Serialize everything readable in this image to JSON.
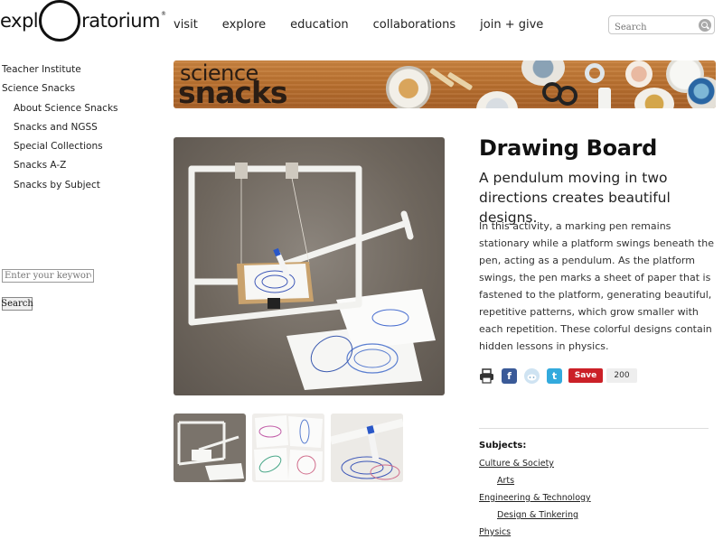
{
  "header": {
    "logo_left": "expl",
    "logo_right": "ratorium",
    "logo_mark": "®",
    "nav": [
      "visit",
      "explore",
      "education",
      "collaborations",
      "join + give"
    ],
    "search_placeholder": "Search"
  },
  "sidebar": {
    "items": [
      {
        "label": "Teacher Institute",
        "level": 0
      },
      {
        "label": "Science Snacks",
        "level": 0
      },
      {
        "label": "About Science Snacks",
        "level": 1
      },
      {
        "label": "Snacks and NGSS",
        "level": 1
      },
      {
        "label": "Special Collections",
        "level": 1
      },
      {
        "label": "Snacks A-Z",
        "level": 1
      },
      {
        "label": "Snacks by Subject",
        "level": 1
      }
    ],
    "search_placeholder": "Enter your keywords",
    "search_button": "Search"
  },
  "banner": {
    "line1": "science",
    "line2": "snacks"
  },
  "article": {
    "title": "Drawing Board",
    "subtitle": "A pendulum moving in two directions creates beautiful designs.",
    "body": "In this activity, a marking pen remains stationary while a platform swings beneath the pen, acting as a pendulum. As the platform swings, the pen marks a sheet of paper that is fastened to the platform, generating beautiful, repetitive patterns, which grow smaller with each repetition. These colorful designs contain hidden lessons in physics."
  },
  "share": {
    "icons": [
      "print-icon",
      "facebook-icon",
      "reddit-icon",
      "twitter-icon"
    ],
    "pin_label": "Save",
    "pin_count": "200"
  },
  "subjects": {
    "label": "Subjects:",
    "items": [
      {
        "label": "Culture & Society",
        "level": 0
      },
      {
        "label": "Arts",
        "level": 1
      },
      {
        "label": "Engineering & Technology",
        "level": 0
      },
      {
        "label": "Design & Tinkering",
        "level": 1
      },
      {
        "label": "Physics",
        "level": 0
      }
    ]
  },
  "colors": {
    "accent_pin": "#cb2027",
    "facebook": "#3a5a98",
    "twitter": "#33aadd",
    "banner_wood": "#b9702f"
  }
}
